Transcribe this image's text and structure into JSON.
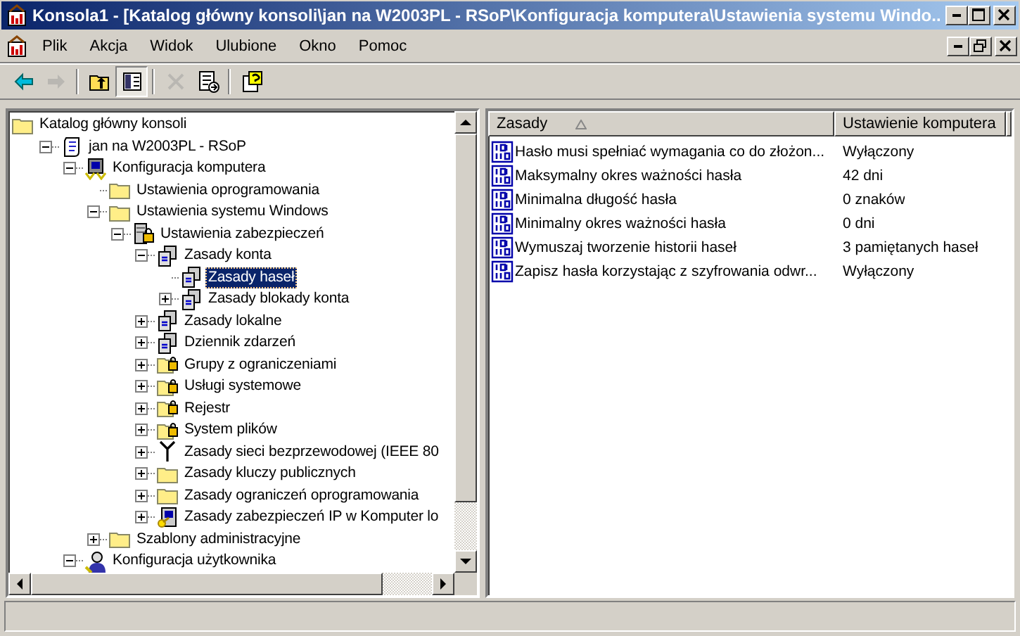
{
  "window": {
    "title": "Konsola1 - [Katalog główny konsoli\\jan na W2003PL - RSoP\\Konfiguracja komputera\\Ustawienia systemu Windo..."
  },
  "menu": [
    {
      "label": "Plik"
    },
    {
      "label": "Akcja"
    },
    {
      "label": "Widok"
    },
    {
      "label": "Ulubione"
    },
    {
      "label": "Okno"
    },
    {
      "label": "Pomoc"
    }
  ],
  "toolbar": [
    {
      "kind": "back",
      "disabled": false,
      "pressed": false
    },
    {
      "kind": "forward",
      "disabled": true,
      "pressed": false
    },
    {
      "kind": "sep"
    },
    {
      "kind": "up",
      "disabled": false,
      "pressed": false
    },
    {
      "kind": "tree",
      "disabled": false,
      "pressed": true
    },
    {
      "kind": "sep"
    },
    {
      "kind": "delete",
      "disabled": true,
      "pressed": false
    },
    {
      "kind": "export",
      "disabled": false,
      "pressed": false
    },
    {
      "kind": "sep"
    },
    {
      "kind": "help",
      "disabled": false,
      "pressed": false
    }
  ],
  "tree": [
    {
      "label": "Katalog główny konsoli",
      "kind": "folder",
      "selected": false,
      "children": [
        {
          "label": "jan na W2003PL - RSoP",
          "kind": "rsop",
          "expanded": true,
          "selected": false,
          "children": [
            {
              "label": "Konfiguracja komputera",
              "kind": "computer",
              "expanded": true,
              "selected": false,
              "children": [
                {
                  "label": "Ustawienia oprogramowania",
                  "kind": "folder",
                  "selected": false
                },
                {
                  "label": "Ustawienia systemu Windows",
                  "kind": "folder",
                  "expanded": true,
                  "selected": false,
                  "children": [
                    {
                      "label": "Ustawienia zabezpieczeń",
                      "kind": "security",
                      "expanded": true,
                      "selected": false,
                      "children": [
                        {
                          "label": "Zasady konta",
                          "kind": "policy",
                          "expanded": true,
                          "selected": false,
                          "children": [
                            {
                              "label": "Zasady haseł",
                              "kind": "policy",
                              "selected": true
                            },
                            {
                              "label": "Zasady blokady konta",
                              "kind": "policy",
                              "expanded": false,
                              "selected": false
                            }
                          ]
                        },
                        {
                          "label": "Zasady lokalne",
                          "kind": "policy",
                          "expanded": false,
                          "selected": false
                        },
                        {
                          "label": "Dziennik zdarzeń",
                          "kind": "policy",
                          "expanded": false,
                          "selected": false
                        },
                        {
                          "label": "Grupy z ograniczeniami",
                          "kind": "lockfolder",
                          "expanded": false,
                          "selected": false
                        },
                        {
                          "label": "Usługi systemowe",
                          "kind": "lockfolder",
                          "expanded": false,
                          "selected": false
                        },
                        {
                          "label": "Rejestr",
                          "kind": "lockfolder",
                          "expanded": false,
                          "selected": false
                        },
                        {
                          "label": "System plików",
                          "kind": "lockfolder",
                          "expanded": false,
                          "selected": false
                        },
                        {
                          "label": "Zasady sieci bezprzewodowej (IEEE 80",
                          "kind": "antenna",
                          "expanded": false,
                          "selected": false
                        },
                        {
                          "label": "Zasady kluczy publicznych",
                          "kind": "folder",
                          "expanded": false,
                          "selected": false
                        },
                        {
                          "label": "Zasady ograniczeń oprogramowania",
                          "kind": "folder",
                          "expanded": false,
                          "selected": false
                        },
                        {
                          "label": "Zasady zabezpieczeń IP w Komputer lo",
                          "kind": "ipsec",
                          "expanded": false,
                          "selected": false
                        }
                      ]
                    }
                  ]
                },
                {
                  "label": "Szablony administracyjne",
                  "kind": "folder",
                  "expanded": false,
                  "selected": false
                }
              ]
            },
            {
              "label": "Konfiguracja użytkownika",
              "kind": "user",
              "expanded": true,
              "selected": false
            }
          ]
        }
      ]
    }
  ],
  "list": {
    "columns": [
      {
        "label": "Zasady",
        "sorted": true
      },
      {
        "label": "Ustawienie komputera",
        "sorted": false
      }
    ],
    "rows": [
      {
        "policy": "Hasło musi spełniać wymagania co do złożon...",
        "setting": "Wyłączony"
      },
      {
        "policy": "Maksymalny okres ważności hasła",
        "setting": "42 dni"
      },
      {
        "policy": "Minimalna długość hasła",
        "setting": "0 znaków"
      },
      {
        "policy": "Minimalny okres ważności hasła",
        "setting": "0 dni"
      },
      {
        "policy": "Wymuszaj tworzenie historii haseł",
        "setting": "3 pamiętanych haseł"
      },
      {
        "policy": "Zapisz hasła korzystając z szyfrowania odwr...",
        "setting": "Wyłączony"
      }
    ]
  }
}
